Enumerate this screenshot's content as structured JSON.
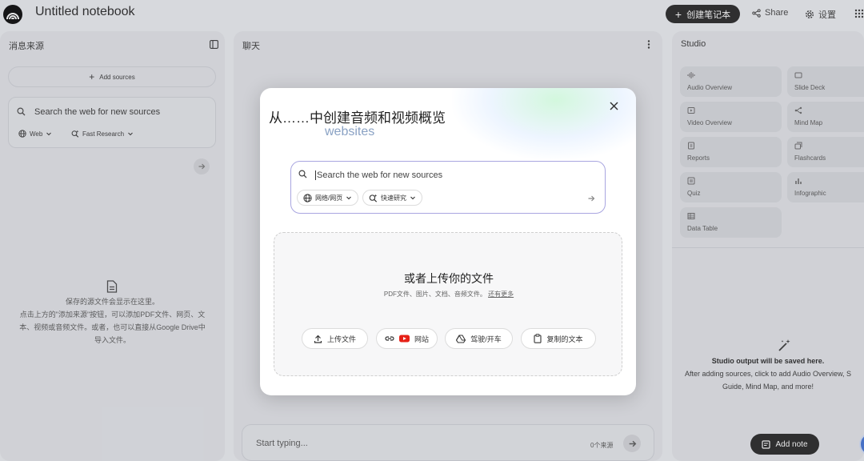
{
  "app": {
    "title": "Untitled notebook",
    "create_label": "创建笔记本",
    "share_label": "Share",
    "settings_label": "设置"
  },
  "sources": {
    "title": "消息来源",
    "add_sources": "Add sources",
    "search_placeholder": "Search the web for new sources",
    "web_chip": "Web",
    "research_chip": "Fast Research",
    "empty_line1": "保存的源文件会显示在这里。",
    "empty_line2": "点击上方的\"添加来源\"按钮，可以添加PDF文件、网页、文",
    "empty_line3": "本、视频或音频文件。或者，也可以直接从Google Drive中",
    "empty_line4": "导入文件。"
  },
  "chat": {
    "title": "聊天",
    "input_placeholder": "Start typing...",
    "source_count": "0个来源"
  },
  "studio": {
    "title": "Studio",
    "tiles": [
      {
        "label": "Audio Overview",
        "icon": "audio-waveform-icon"
      },
      {
        "label": "Slide Deck",
        "icon": "slides-icon"
      },
      {
        "label": "Video Overview",
        "icon": "video-icon"
      },
      {
        "label": "Mind Map",
        "icon": "mind-map-icon"
      },
      {
        "label": "Reports",
        "icon": "reports-icon"
      },
      {
        "label": "Flashcards",
        "icon": "flashcards-icon"
      },
      {
        "label": "Quiz",
        "icon": "quiz-icon"
      },
      {
        "label": "Infographic",
        "icon": "infographic-icon"
      },
      {
        "label": "Data Table",
        "icon": "table-icon"
      }
    ],
    "empty_title": "Studio output will be saved here.",
    "empty_line1": "After adding sources, click to add Audio Overview, S",
    "empty_line2": "Guide, Mind Map, and more!",
    "add_note": "Add note"
  },
  "modal": {
    "title": "从……中创建音频和视频概览",
    "subtitle": "websites",
    "search_placeholder": "Search the web for new sources",
    "chip_web": "网络/网页",
    "chip_research": "快速研究",
    "upload_title": "或者上传你的文件",
    "upload_sub": "PDF文件、图片、文档、音频文件。",
    "upload_more": "还有更多",
    "buttons": {
      "upload": "上传文件",
      "website": "网站",
      "drive": "驾驶/开车",
      "copied": "复制的文本"
    }
  },
  "colors": {
    "accent_dark": "#1f1f1f",
    "search_border": "#a9a6e0",
    "subtitle": "#8aa2c4",
    "youtube_red": "#e62117"
  }
}
